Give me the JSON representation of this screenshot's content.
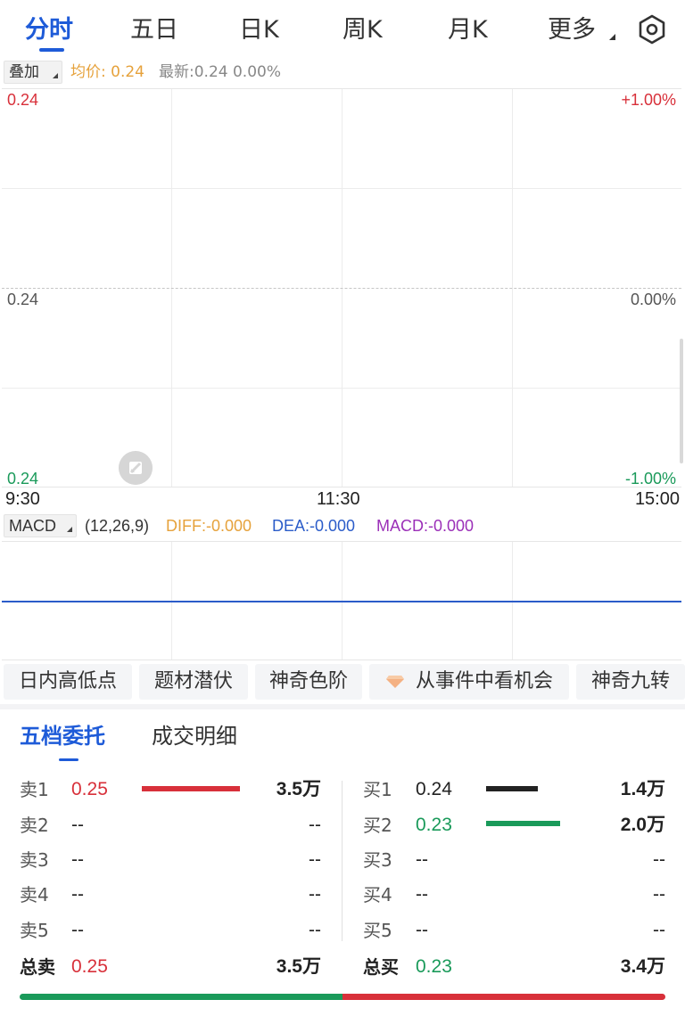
{
  "tabs": [
    "分时",
    "五日",
    "日K",
    "周K",
    "月K",
    "更多"
  ],
  "overlay": {
    "button": "叠加",
    "avg": "均价: 0.24",
    "latest": "最新:0.24 0.00%"
  },
  "chart": {
    "left_top": "0.24",
    "left_mid": "0.24",
    "left_bottom": "0.24",
    "right_top": "+1.00%",
    "right_mid": "0.00%",
    "right_bottom": "-1.00%",
    "time_start": "9:30",
    "time_mid": "11:30",
    "time_end": "15:00"
  },
  "macd": {
    "button": "MACD",
    "params": "(12,26,9)",
    "diff": "DIFF:-0.000",
    "dea": "DEA:-0.000",
    "macd": "MACD:-0.000"
  },
  "chips": [
    "日内高低点",
    "题材潜伏",
    "神奇色阶",
    "从事件中看机会",
    "神奇九转"
  ],
  "orderbook": {
    "tabs": [
      "五档委托",
      "成交明细"
    ],
    "sell": [
      {
        "label": "卖1",
        "price": "0.25",
        "volume": "3.5万",
        "bar_fraction": 1.0
      },
      {
        "label": "卖2",
        "price": "--",
        "volume": "--"
      },
      {
        "label": "卖3",
        "price": "--",
        "volume": "--"
      },
      {
        "label": "卖4",
        "price": "--",
        "volume": "--"
      },
      {
        "label": "卖5",
        "price": "--",
        "volume": "--"
      }
    ],
    "buy": [
      {
        "label": "买1",
        "price": "0.24",
        "volume": "1.4万",
        "bar_fraction": 0.4
      },
      {
        "label": "买2",
        "price": "0.23",
        "volume": "2.0万",
        "bar_fraction": 0.57
      },
      {
        "label": "买3",
        "price": "--",
        "volume": "--"
      },
      {
        "label": "买4",
        "price": "--",
        "volume": "--"
      },
      {
        "label": "买5",
        "price": "--",
        "volume": "--"
      }
    ],
    "total_sell": {
      "label": "总卖",
      "price": "0.25",
      "volume": "3.5万"
    },
    "total_buy": {
      "label": "总买",
      "price": "0.23",
      "volume": "3.4万"
    },
    "buy_ratio": 0.5
  },
  "colors": {
    "accent": "#1e5bd8",
    "up": "#d8303a",
    "down": "#1a9a5a",
    "avg": "#e6a23c",
    "macd_line": "#2b5cc9"
  }
}
